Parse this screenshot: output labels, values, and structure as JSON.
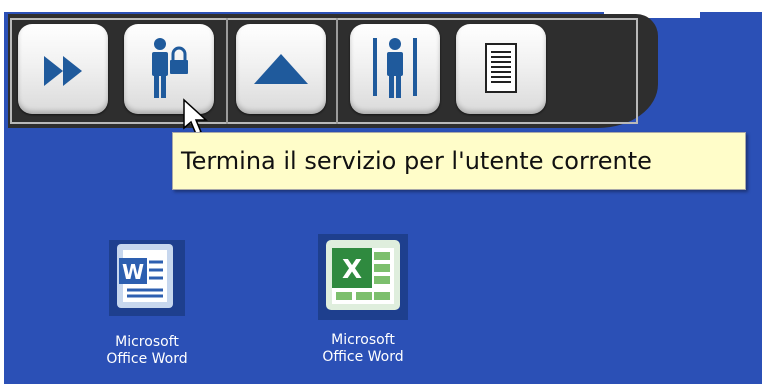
{
  "toolbar": {
    "buttons": [
      {
        "name": "fast-forward",
        "icon": "fast-forward-icon"
      },
      {
        "name": "lock-user",
        "icon": "user-lock-icon"
      },
      {
        "name": "eject",
        "icon": "eject-icon"
      },
      {
        "name": "user-switch",
        "icon": "user-pillar-icon"
      },
      {
        "name": "document",
        "icon": "document-lines-icon"
      }
    ]
  },
  "tooltip": {
    "text": "Termina il servizio per l'utente corrente"
  },
  "desktop": {
    "background": "#2b50b6",
    "icons": [
      {
        "label_line1": "Microsoft",
        "label_line2": "Office Word",
        "icon": "word-icon"
      },
      {
        "label_line1": "Microsoft",
        "label_line2": "Office Word",
        "icon": "excel-icon"
      }
    ]
  },
  "colors": {
    "accent_blue": "#1f5a9c",
    "toolbar_bg": "#2e2e2e",
    "tooltip_bg": "#fffdc9"
  }
}
